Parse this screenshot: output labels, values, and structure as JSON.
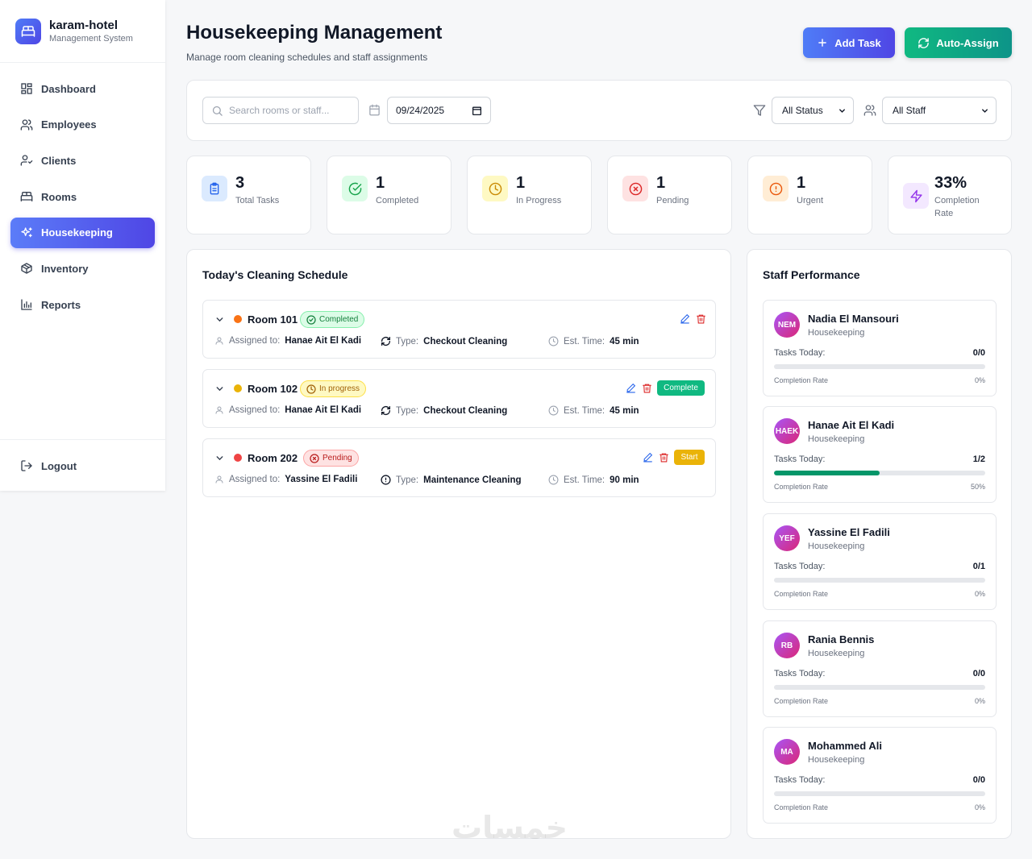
{
  "brand": {
    "name": "karam-hotel",
    "subtitle": "Management System"
  },
  "nav": {
    "items": [
      {
        "label": "Dashboard",
        "icon": "dashboard-icon"
      },
      {
        "label": "Employees",
        "icon": "users-icon"
      },
      {
        "label": "Clients",
        "icon": "user-check-icon"
      },
      {
        "label": "Rooms",
        "icon": "bed-icon"
      },
      {
        "label": "Housekeeping",
        "icon": "sparkles-icon",
        "active": true
      },
      {
        "label": "Inventory",
        "icon": "package-icon"
      },
      {
        "label": "Reports",
        "icon": "bar-chart-icon"
      }
    ],
    "logout": "Logout"
  },
  "header": {
    "title": "Housekeeping Management",
    "subtitle": "Manage room cleaning schedules and staff assignments",
    "add_task": "Add Task",
    "auto_assign": "Auto-Assign"
  },
  "filters": {
    "search_placeholder": "Search rooms or staff...",
    "date": "09/24/2025",
    "status": "All Status",
    "staff": "All Staff"
  },
  "stats": [
    {
      "value": "3",
      "label": "Total Tasks",
      "icon": "clipboard-icon",
      "color": "#2563eb",
      "bg": "#dbeafe"
    },
    {
      "value": "1",
      "label": "Completed",
      "icon": "check-circle-icon",
      "color": "#16a34a",
      "bg": "#dcfce7"
    },
    {
      "value": "1",
      "label": "In Progress",
      "icon": "clock-icon",
      "color": "#ca8a04",
      "bg": "#fef9c3"
    },
    {
      "value": "1",
      "label": "Pending",
      "icon": "x-circle-icon",
      "color": "#dc2626",
      "bg": "#fee2e2"
    },
    {
      "value": "1",
      "label": "Urgent",
      "icon": "alert-circle-icon",
      "color": "#ea580c",
      "bg": "#ffedd5"
    },
    {
      "value": "33%",
      "label": "Completion Rate",
      "icon": "zap-icon",
      "color": "#9333ea",
      "bg": "#f3e8ff"
    }
  ],
  "schedule": {
    "title": "Today's Cleaning Schedule",
    "tasks": [
      {
        "room": "Room 101",
        "dot_color": "#f97316",
        "status": "Completed",
        "assigned_label": "Assigned to:",
        "assigned": "Hanae Ait El Kadi",
        "type_label": "Type:",
        "type": "Checkout Cleaning",
        "time_label": "Est. Time:",
        "time": "45 min",
        "action": ""
      },
      {
        "room": "Room 102",
        "dot_color": "#eab308",
        "status": "In progress",
        "assigned_label": "Assigned to:",
        "assigned": "Hanae Ait El Kadi",
        "type_label": "Type:",
        "type": "Checkout Cleaning",
        "time_label": "Est. Time:",
        "time": "45 min",
        "action": "Complete"
      },
      {
        "room": "Room 202",
        "dot_color": "#ef4444",
        "status": "Pending",
        "assigned_label": "Assigned to:",
        "assigned": "Yassine El Fadili",
        "type_label": "Type:",
        "type": "Maintenance Cleaning",
        "time_label": "Est. Time:",
        "time": "90 min",
        "action": "Start"
      }
    ]
  },
  "staff": {
    "title": "Staff Performance",
    "tasks_label": "Tasks Today:",
    "rate_label": "Completion Rate",
    "members": [
      {
        "initials": "NEM",
        "name": "Nadia El Mansouri",
        "role": "Housekeeping",
        "tasks": "0/0",
        "rate": "0%",
        "progress": 0
      },
      {
        "initials": "HAEK",
        "name": "Hanae Ait El Kadi",
        "role": "Housekeeping",
        "tasks": "1/2",
        "rate": "50%",
        "progress": 0.5
      },
      {
        "initials": "YEF",
        "name": "Yassine El Fadili",
        "role": "Housekeeping",
        "tasks": "0/1",
        "rate": "0%",
        "progress": 0
      },
      {
        "initials": "RB",
        "name": "Rania Bennis",
        "role": "Housekeeping",
        "tasks": "0/0",
        "rate": "0%",
        "progress": 0
      },
      {
        "initials": "MA",
        "name": "Mohammed Ali",
        "role": "Housekeeping",
        "tasks": "0/0",
        "rate": "0%",
        "progress": 0
      }
    ]
  },
  "watermark": "خمسات"
}
